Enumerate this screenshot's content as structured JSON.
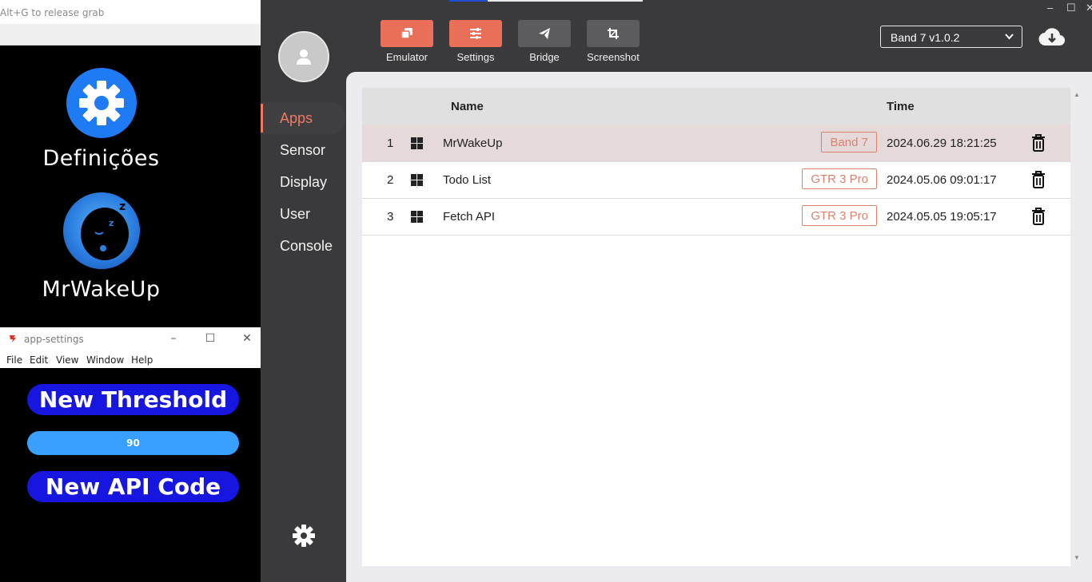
{
  "emulator": {
    "hint": "Alt+G to release grab",
    "apps": [
      {
        "label": "Definições",
        "icon": "gear-icon"
      },
      {
        "label": "MrWakeUp",
        "icon": "sleeping-face-icon"
      }
    ]
  },
  "settings_window": {
    "title": "app-settings",
    "menu": [
      "File",
      "Edit",
      "View",
      "Window",
      "Help"
    ],
    "threshold_button": "New Threshold",
    "slider_value": "90",
    "api_button": "New API Code",
    "colors": {
      "button": "#1616e0",
      "slider": "#3aa0ff"
    }
  },
  "toolbar": {
    "buttons": [
      {
        "label": "Emulator",
        "icon": "copy-icon",
        "color": "#ea6f59"
      },
      {
        "label": "Settings",
        "icon": "sliders-icon",
        "color": "#ea6f59"
      },
      {
        "label": "Bridge",
        "icon": "paper-plane-icon",
        "color": "#5c5c5e"
      },
      {
        "label": "Screenshot",
        "icon": "crop-icon",
        "color": "#5c5c5e"
      }
    ]
  },
  "device_select": {
    "value": "Band 7 v1.0.2"
  },
  "nav": {
    "items": [
      "Apps",
      "Sensor",
      "Display",
      "User",
      "Console"
    ],
    "active": "Apps",
    "accent": "#ee7a63"
  },
  "table": {
    "columns": {
      "name": "Name",
      "time": "Time"
    },
    "rows": [
      {
        "index": "1",
        "name": "MrWakeUp",
        "device": "Band 7",
        "time": "2024.06.29 18:21:25",
        "selected": true
      },
      {
        "index": "2",
        "name": "Todo List",
        "device": "GTR 3 Pro",
        "time": "2024.05.06 09:01:17",
        "selected": false
      },
      {
        "index": "3",
        "name": "Fetch API",
        "device": "GTR 3 Pro",
        "time": "2024.05.05 19:05:17",
        "selected": false
      }
    ]
  }
}
